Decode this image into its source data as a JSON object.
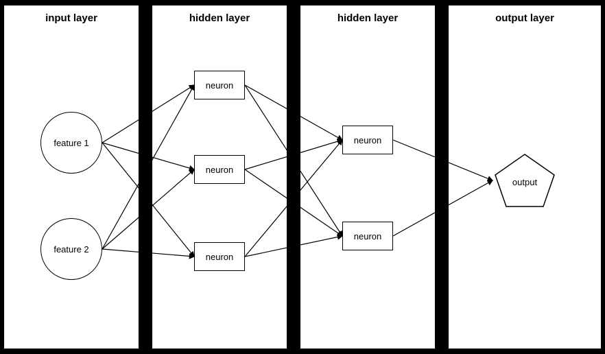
{
  "layers": [
    {
      "id": "input-layer",
      "title": "input layer",
      "nodes": [
        {
          "id": "f1",
          "label": "feature 1",
          "type": "circle"
        },
        {
          "id": "f2",
          "label": "feature 2",
          "type": "circle"
        }
      ]
    },
    {
      "id": "hidden-layer-1",
      "title": "hidden layer",
      "nodes": [
        {
          "id": "h1n1",
          "label": "neuron",
          "type": "box"
        },
        {
          "id": "h1n2",
          "label": "neuron",
          "type": "box"
        },
        {
          "id": "h1n3",
          "label": "neuron",
          "type": "box"
        }
      ]
    },
    {
      "id": "hidden-layer-2",
      "title": "hidden layer",
      "nodes": [
        {
          "id": "h2n1",
          "label": "neuron",
          "type": "box"
        },
        {
          "id": "h2n2",
          "label": "neuron",
          "type": "box"
        }
      ]
    },
    {
      "id": "output-layer",
      "title": "output layer",
      "nodes": [
        {
          "id": "out1",
          "label": "output",
          "type": "pentagon"
        }
      ]
    }
  ]
}
